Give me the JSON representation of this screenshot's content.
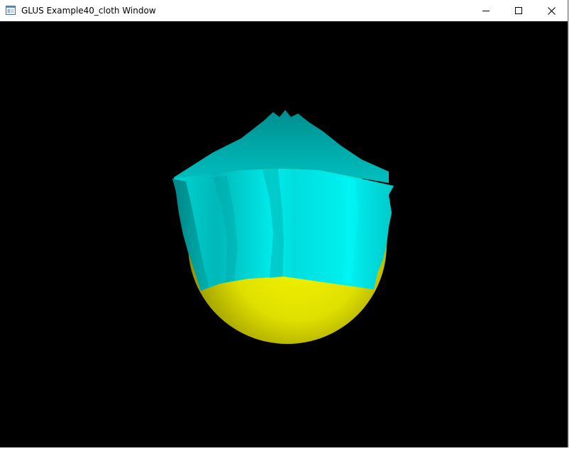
{
  "window": {
    "title": "GLUS Example40_cloth Window",
    "minimize_icon": "minimize-icon",
    "maximize_icon": "maximize-icon",
    "close_icon": "close-icon",
    "app_icon": "window-app-icon"
  },
  "scene": {
    "background_color": "#000000",
    "sphere_color": "#e6e600",
    "cloth_color": "#00e0e0"
  }
}
